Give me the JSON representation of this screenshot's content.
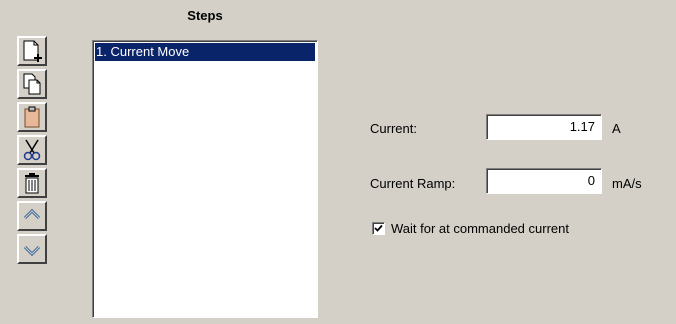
{
  "steps_panel": {
    "title": "Steps",
    "toolbar": [
      {
        "icon": "new-step-icon"
      },
      {
        "icon": "copy-icon"
      },
      {
        "icon": "paste-icon"
      },
      {
        "icon": "cut-icon"
      },
      {
        "icon": "delete-icon"
      },
      {
        "icon": "move-up-icon"
      },
      {
        "icon": "move-down-icon"
      }
    ],
    "items": [
      {
        "label": "1. Current Move",
        "selected": true
      }
    ]
  },
  "properties": {
    "current": {
      "label": "Current:",
      "value": "1.17",
      "unit": "A"
    },
    "current_ramp": {
      "label": "Current Ramp:",
      "value": "0",
      "unit": "mA/s"
    },
    "wait_checkbox": {
      "label": "Wait for at commanded current",
      "checked": true
    }
  },
  "colors": {
    "background": "#d4d0c8",
    "selection": "#0a246a"
  }
}
